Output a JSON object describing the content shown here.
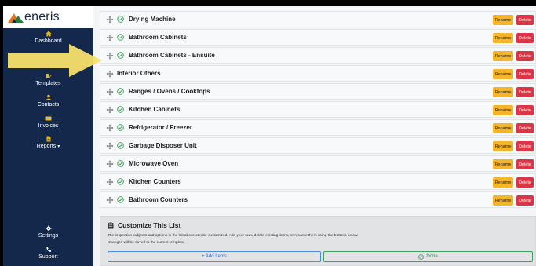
{
  "app": {
    "logo_text": "eneris"
  },
  "sidebar": {
    "items": [
      {
        "label": "Dashboard",
        "icon": "home-icon"
      },
      {
        "label": "Templates",
        "icon": "templates-icon"
      },
      {
        "label": "Contacts",
        "icon": "user-icon"
      },
      {
        "label": "Invoices",
        "icon": "invoice-icon"
      },
      {
        "label": "Reports",
        "icon": "report-icon",
        "caret": "▾"
      },
      {
        "label": "Settings",
        "icon": "gear-icon"
      },
      {
        "label": "Support",
        "icon": "phone-icon"
      }
    ]
  },
  "list": {
    "rename_label": "Rename",
    "delete_label": "Delete",
    "items": [
      {
        "label": "Drying Machine",
        "checked": true
      },
      {
        "label": "Bathroom Cabinets",
        "checked": true
      },
      {
        "label": "Bathroom Cabinets - Ensuite",
        "checked": true
      },
      {
        "label": "Interior Others",
        "checked": false
      },
      {
        "label": "Ranges / Ovens / Cooktops",
        "checked": true
      },
      {
        "label": "Kitchen Cabinets",
        "checked": true
      },
      {
        "label": "Refrigerator / Freezer",
        "checked": true
      },
      {
        "label": "Garbage Disposer Unit",
        "checked": true
      },
      {
        "label": "Microwave Oven",
        "checked": true
      },
      {
        "label": "Kitchen Counters",
        "checked": true
      },
      {
        "label": "Bathroom Counters",
        "checked": true
      }
    ]
  },
  "customize": {
    "title": "Customize This List",
    "desc_line1": "The inspection subjects and options in the list above can be customized. Add your own, delete existing items, or rename them using the buttons below.",
    "desc_line2": "Changes will be saved to the current template.",
    "add_label": "+ Add Items",
    "done_label": "Done"
  },
  "colors": {
    "sidebar_bg": "#13284b",
    "accent_yellow": "#f5b52a",
    "delete_red": "#dc3545",
    "check_green": "#2e9b4e",
    "arrow_yellow": "#f7df6a"
  }
}
